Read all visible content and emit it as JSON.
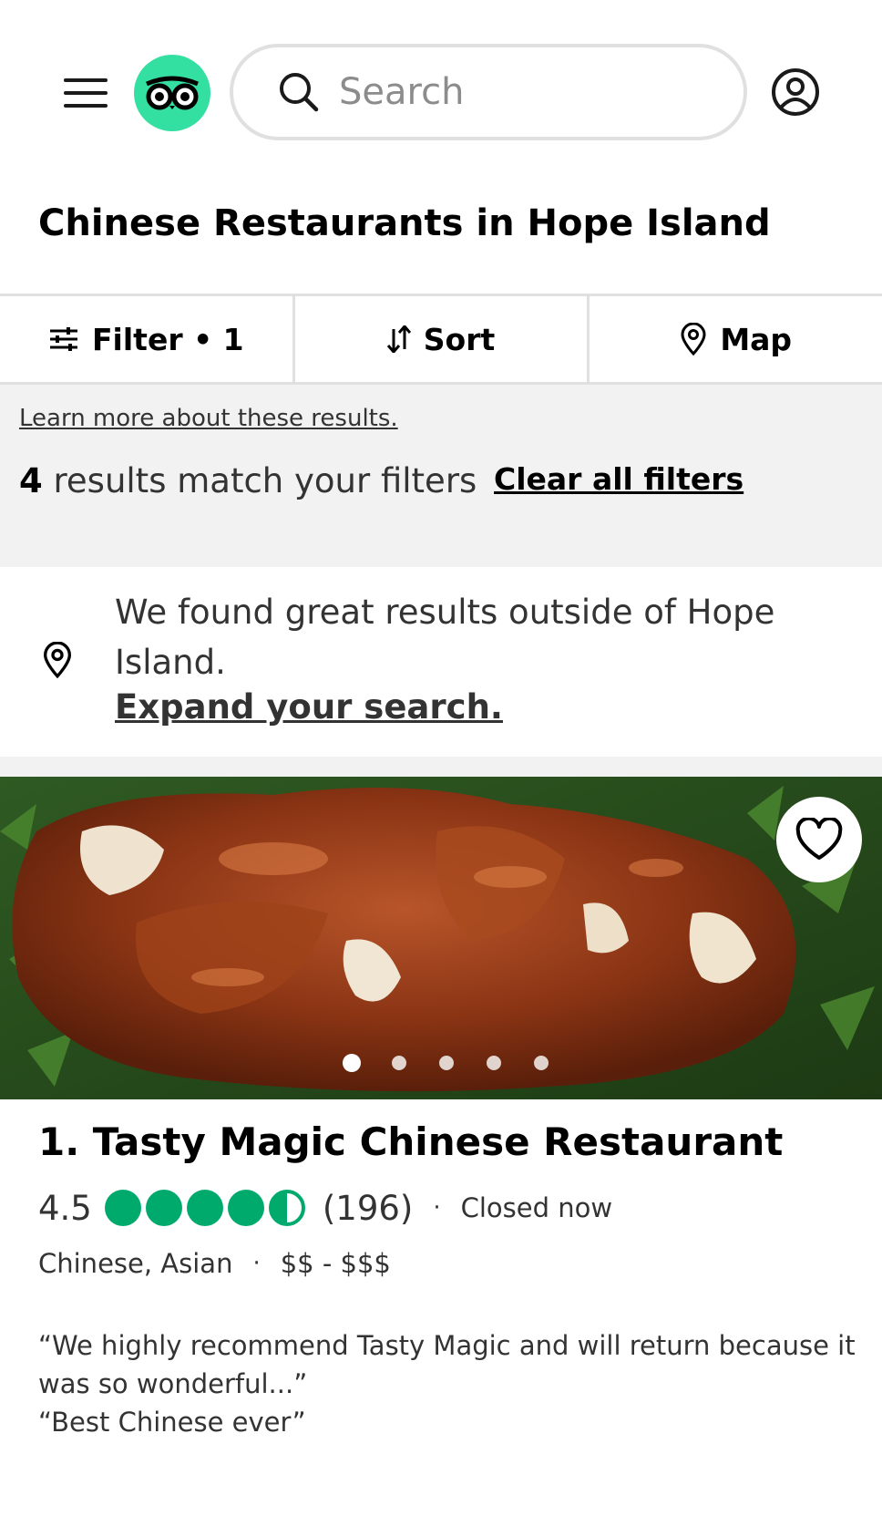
{
  "header": {
    "search_placeholder": "Search",
    "menu_icon": "hamburger-menu-icon",
    "logo_icon": "owl-logo-icon",
    "account_icon": "account-icon",
    "logo_color": "#34e0a1"
  },
  "page": {
    "title": "Chinese Restaurants in Hope Island"
  },
  "toolbar": {
    "filter_label": "Filter • 1",
    "sort_label": "Sort",
    "map_label": "Map"
  },
  "notice": {
    "learn_more": "Learn more about these results.",
    "results_count": "4",
    "results_text": " results match your filters",
    "clear_filters": "Clear all filters"
  },
  "expand": {
    "text": "We found great results outside of Hope Island.",
    "link": "Expand your search."
  },
  "listing": {
    "name": "1. Tasty Magic Chinese Restaurant",
    "rating": "4.5",
    "rating_value": 4.5,
    "rating_max": 5,
    "review_count": "(196)",
    "status": "Closed now",
    "cuisine": "Chinese, Asian",
    "price": "$$ - $$$",
    "quotes": [
      "“We highly recommend Tasty Magic and will return because it was so wonderful...”",
      "“Best Chinese ever”"
    ],
    "photo_count": 5,
    "active_photo": 1,
    "bubble_color": "#00aa6c"
  }
}
